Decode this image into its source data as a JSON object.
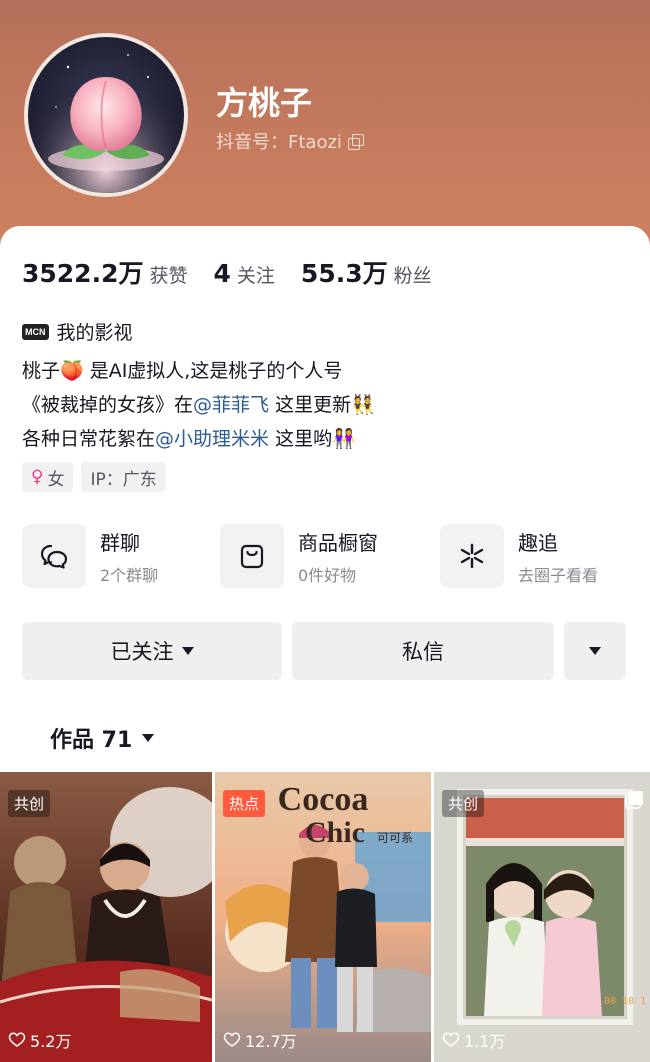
{
  "profile": {
    "name": "方桃子",
    "douyin_id": "抖音号：Ftaozi"
  },
  "stats": [
    {
      "num": "3522.2万",
      "label": "获赞"
    },
    {
      "num": "4",
      "label": "关注"
    },
    {
      "num": "55.3万",
      "label": "粉丝"
    }
  ],
  "mcn": {
    "icon_text": "MCN",
    "label": "我的影视"
  },
  "bio": {
    "line1": "桃子🍑 是AI虚拟人,这是桃子的个人号",
    "line2_a": "《被裁掉的女孩》在",
    "line2_mention": "@菲菲飞",
    "line2_b": " 这里更新👯",
    "line3_a": "各种日常花絮在",
    "line3_mention": "@小助理米米",
    "line3_b": " 这里哟👭"
  },
  "tags": {
    "gender": "女",
    "gender_icon": "♀",
    "ip": "IP：广东"
  },
  "features": [
    {
      "title": "群聊",
      "sub": "2个群聊",
      "icon": "chat-bubbles-icon"
    },
    {
      "title": "商品橱窗",
      "sub": "0件好物",
      "icon": "shopping-bag-icon"
    },
    {
      "title": "趣追",
      "sub": "去圈子看看",
      "icon": "sparkle-icon"
    }
  ],
  "actions": {
    "followed": "已关注",
    "message": "私信"
  },
  "works": {
    "label": "作品 71"
  },
  "videos": [
    {
      "badge": "共创",
      "likes": "5.2万"
    },
    {
      "badge": "热点",
      "likes": "12.7万",
      "title_art": "Cocoa Chic",
      "title_sub": "可可系"
    },
    {
      "badge": "共创",
      "likes": "1.1万",
      "stamp": "00 10 1"
    }
  ],
  "colors": {
    "mention": "#2b5d94",
    "hot_badge": "#fe5a3b",
    "header": "#c3795c"
  }
}
